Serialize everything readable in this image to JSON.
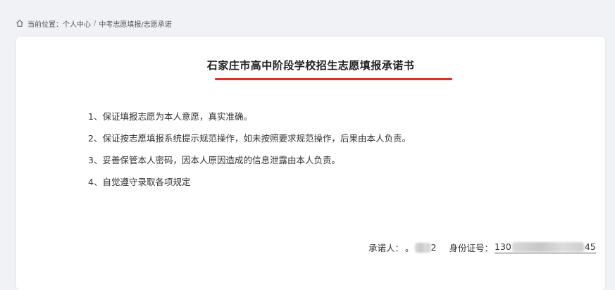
{
  "breadcrumb": {
    "prefix": "当前位置：",
    "items": [
      "个人中心",
      "中考志愿填报/志愿承诺"
    ],
    "separator": "/"
  },
  "document": {
    "title": "石家庄市高中阶段学校招生志愿填报承诺书",
    "clauses": [
      "1、保证填报志愿为本人意愿，真实准确。",
      "2、保证按志愿填报系统提示规范操作，如未按照要求规范操作，后果由本人负责。",
      "3、妥善保管本人密码，因本人原因造成的信息泄露由本人负责。",
      "4、自觉遵守录取各项规定"
    ],
    "signer": {
      "label": "承诺人：",
      "name_start": "。",
      "name_end": "2"
    },
    "id_number": {
      "label": "身份证号：",
      "start": "130",
      "end": "45"
    }
  },
  "colors": {
    "accent": "#d6312b",
    "page_background": "#f1f2f5",
    "card_background": "#ffffff"
  }
}
